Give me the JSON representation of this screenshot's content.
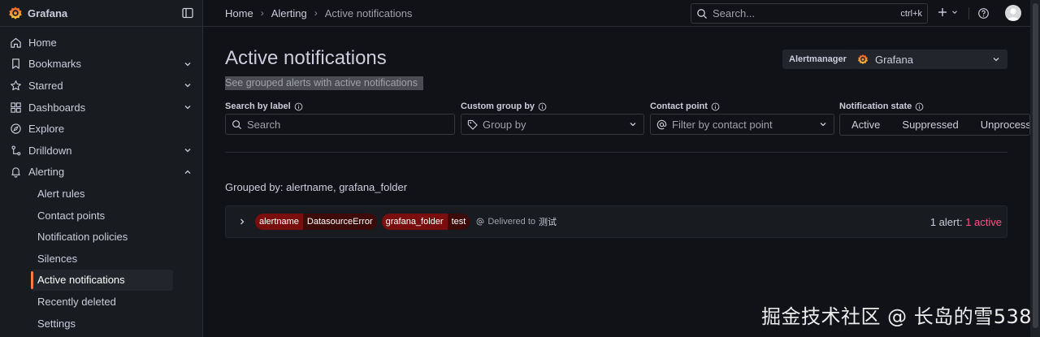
{
  "app": {
    "name": "Grafana"
  },
  "sidebar": {
    "items": [
      {
        "label": "Home",
        "icon": "home-icon",
        "chevron": false
      },
      {
        "label": "Bookmarks",
        "icon": "bookmark-icon",
        "chevron": true
      },
      {
        "label": "Starred",
        "icon": "star-icon",
        "chevron": true
      },
      {
        "label": "Dashboards",
        "icon": "dashboards-grid-icon",
        "chevron": true
      },
      {
        "label": "Explore",
        "icon": "compass-icon",
        "chevron": false
      },
      {
        "label": "Drilldown",
        "icon": "drilldown-icon",
        "chevron": true
      },
      {
        "label": "Alerting",
        "icon": "bell-icon",
        "chevron": true,
        "expanded": true
      }
    ],
    "alerting_children": [
      {
        "label": "Alert rules"
      },
      {
        "label": "Contact points"
      },
      {
        "label": "Notification policies"
      },
      {
        "label": "Silences"
      },
      {
        "label": "Active notifications",
        "active": true
      },
      {
        "label": "Recently deleted"
      },
      {
        "label": "Settings"
      }
    ],
    "active_accent": "#ff7941"
  },
  "topbar": {
    "breadcrumbs": [
      "Home",
      "Alerting",
      "Active notifications"
    ],
    "search": {
      "placeholder": "Search...",
      "shortcut": "ctrl+k"
    }
  },
  "page": {
    "title": "Active notifications",
    "subtitle": "See grouped alerts with active notifications"
  },
  "alertmanager": {
    "label": "Alertmanager",
    "selected": "Grafana"
  },
  "filters": {
    "search_by_label": {
      "label": "Search by label",
      "placeholder": "Search"
    },
    "custom_group_by": {
      "label": "Custom group by",
      "placeholder": "Group by"
    },
    "contact_point": {
      "label": "Contact point",
      "placeholder": "Filter by contact point"
    },
    "notification_state": {
      "label": "Notification state",
      "options": [
        "Active",
        "Suppressed",
        "Unprocessed"
      ]
    }
  },
  "grouped_by": "Grouped by: alertname, grafana_folder",
  "groups": [
    {
      "labels": [
        {
          "key": "alertname",
          "value": "DatasourceError"
        },
        {
          "key": "grafana_folder",
          "value": "test"
        }
      ],
      "delivered_prefix": "Delivered to",
      "delivered_to": "测试",
      "count_text": "1 alert:",
      "active_text": "1 active"
    }
  ],
  "watermark": "掘金技术社区 @ 长岛的雪538",
  "colors": {
    "active": "#ff5286",
    "tag_key": "#7a0e0e",
    "tag_value": "#3d0a0a"
  }
}
